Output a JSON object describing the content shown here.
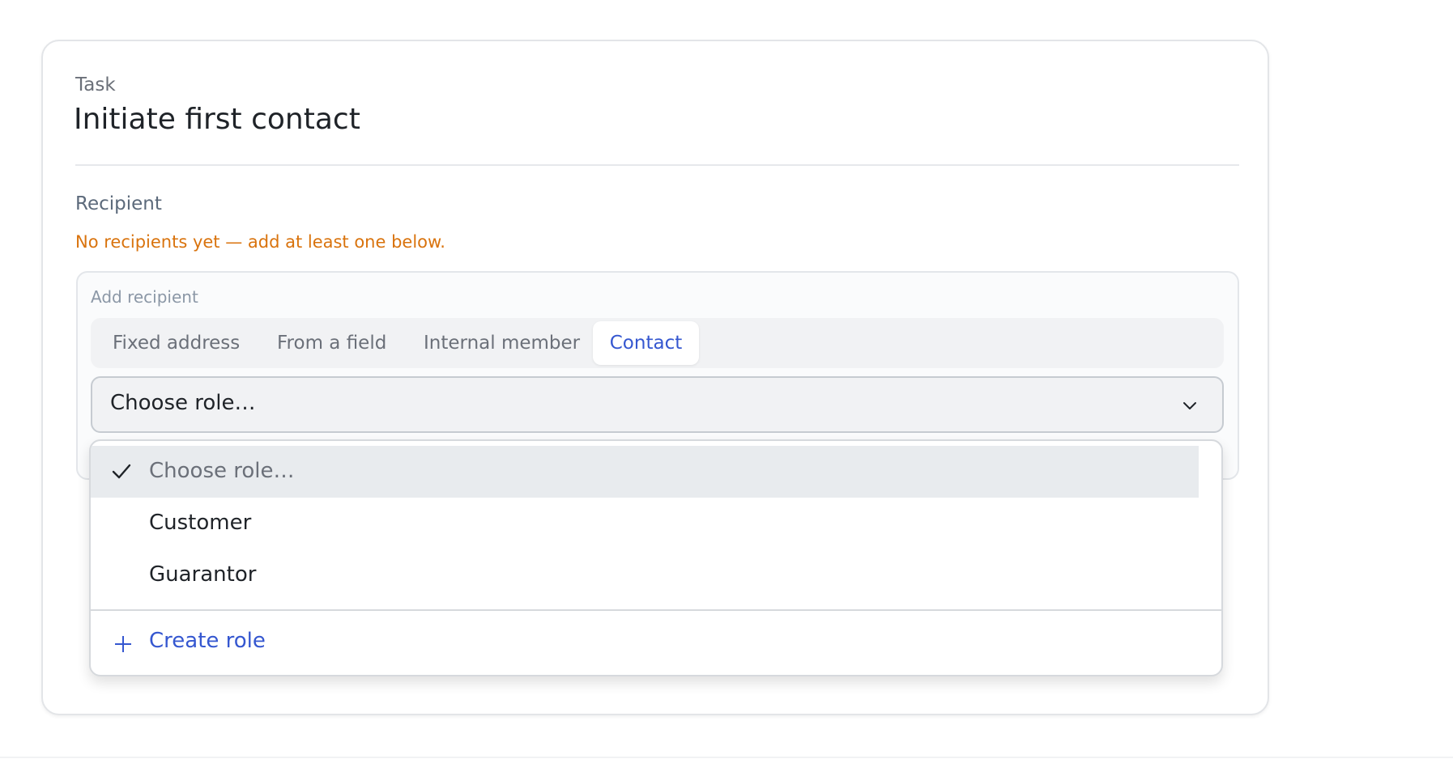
{
  "task": {
    "eyebrow": "Task",
    "title": "Initiate first contact"
  },
  "recipient": {
    "section_label": "Recipient",
    "warning": "No recipients yet — add at least one below.",
    "warning_color": "#d9730d"
  },
  "add_recipient": {
    "label": "Add recipient",
    "tabs": [
      {
        "label": "Fixed address",
        "active": false
      },
      {
        "label": "From a field",
        "active": false
      },
      {
        "label": "Internal member",
        "active": false
      },
      {
        "label": "Contact",
        "active": true
      }
    ],
    "role_select": {
      "value": "Choose role…",
      "icon": "chevron-down-icon"
    }
  },
  "role_dropdown": {
    "options": [
      {
        "label": "Choose role…",
        "selected": true,
        "icon": "check-icon"
      },
      {
        "label": "Customer",
        "selected": false
      },
      {
        "label": "Guarantor",
        "selected": false
      }
    ],
    "create_action": {
      "label": "Create role",
      "icon": "plus-icon"
    }
  },
  "colors": {
    "accent": "#3557d0",
    "selected_row": "#e8ebee"
  }
}
